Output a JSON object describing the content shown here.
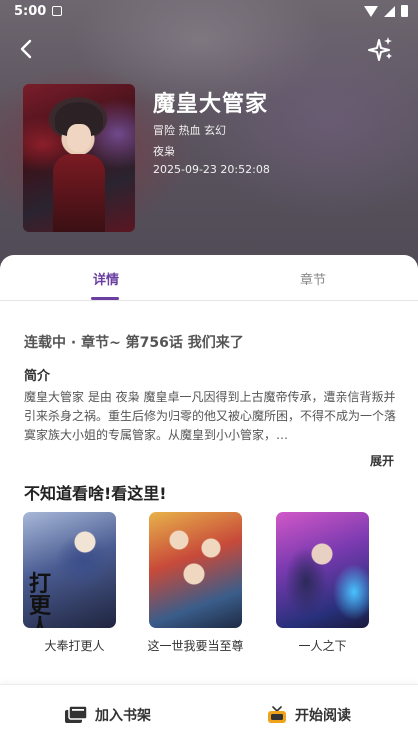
{
  "status_bar": {
    "time": "5:00"
  },
  "header": {
    "title": "魔皇大管家",
    "tags": "冒险 热血 玄幻",
    "author": "夜枭",
    "updated": "2025-09-23 20:52:08"
  },
  "tabs": [
    {
      "label": "详情",
      "active": true
    },
    {
      "label": "章节",
      "active": false
    }
  ],
  "detail": {
    "status_line": "连载中 · 章节~ 第756话 我们来了",
    "intro_heading": "简介",
    "intro_text": "魔皇大管家 是由 夜枭 魔皇卓一凡因得到上古魔帝传承，遭亲信背叛并引来杀身之祸。重生后修为归零的他又被心魔所困，不得不成为一个落寞家族大小姐的专属管家。从魔皇到小小管家，…",
    "expand_label": "展开"
  },
  "recommend": {
    "heading": "不知道看啥!看这里!",
    "items": [
      {
        "title": "大奉打更人",
        "cover_text": "打更人"
      },
      {
        "title": "这一世我要当至尊"
      },
      {
        "title": "一人之下"
      }
    ]
  },
  "bottom_bar": {
    "shelf_label": "加入书架",
    "read_label": "开始阅读"
  },
  "colors": {
    "accent": "#6a3fa0",
    "read_icon": "#f0a21a"
  },
  "icons": {
    "back": "arrow-left-icon",
    "magic": "sparkles-icon",
    "shelf": "books-icon",
    "read": "tv-icon"
  }
}
